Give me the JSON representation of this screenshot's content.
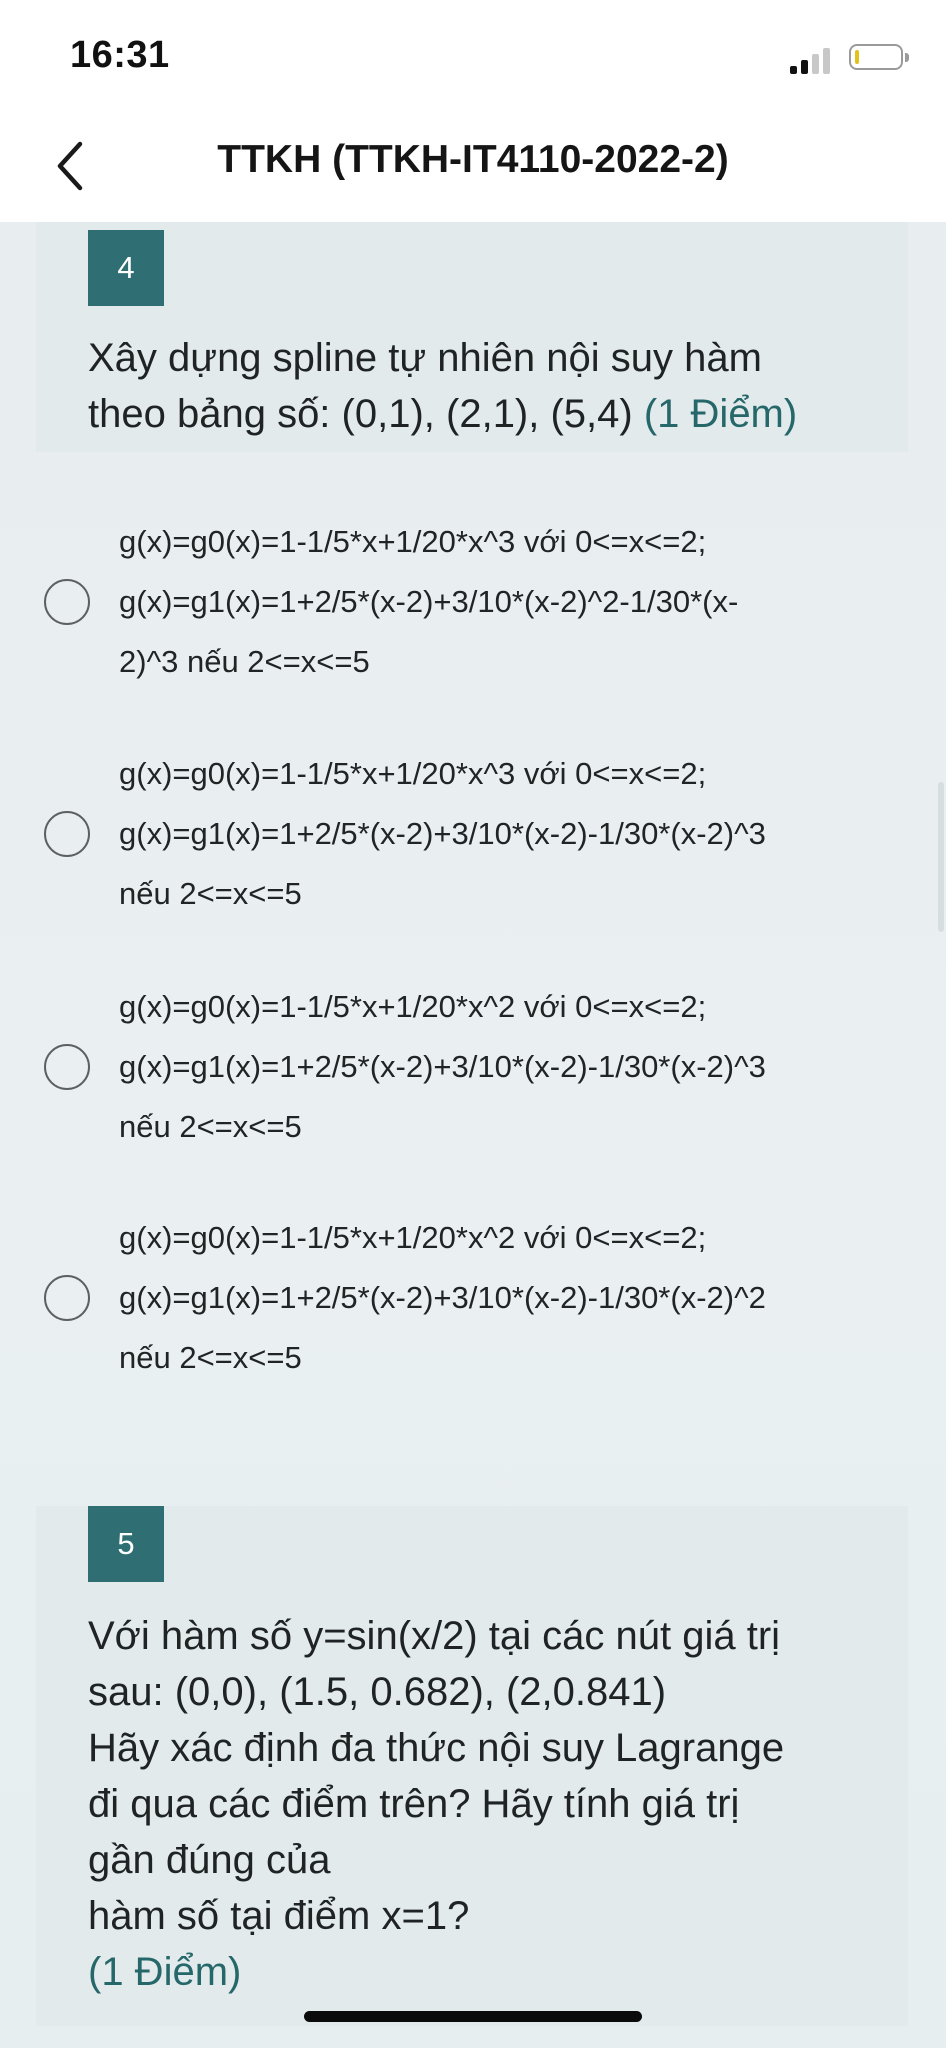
{
  "status_bar": {
    "time": "16:31",
    "battery_color": "#e2c21a"
  },
  "nav": {
    "back_icon": "chevron-left-icon",
    "title": "TTKH (TTKH-IT4110-2022-2)"
  },
  "question4": {
    "number": "4",
    "text": "Xây dựng spline tự nhiên nội suy hàm\ntheo bảng số: (0,1), (2,1), (5,4)",
    "points": "(1 Điểm)",
    "options": [
      {
        "lines": [
          "g(x)=g0(x)=1-1/5*x+1/20*x^3 với 0<=x<=2;",
          "g(x)=g1(x)=1+2/5*(x-2)+3/10*(x-2)^2-1/30*(x-",
          "2)^3 nếu 2<=x<=5"
        ]
      },
      {
        "lines": [
          "g(x)=g0(x)=1-1/5*x+1/20*x^3 với 0<=x<=2;",
          "g(x)=g1(x)=1+2/5*(x-2)+3/10*(x-2)-1/30*(x-2)^3",
          "nếu 2<=x<=5"
        ]
      },
      {
        "lines": [
          "g(x)=g0(x)=1-1/5*x+1/20*x^2 với 0<=x<=2;",
          "g(x)=g1(x)=1+2/5*(x-2)+3/10*(x-2)-1/30*(x-2)^3",
          "nếu 2<=x<=5"
        ]
      },
      {
        "lines": [
          "g(x)=g0(x)=1-1/5*x+1/20*x^2 với 0<=x<=2;",
          "g(x)=g1(x)=1+2/5*(x-2)+3/10*(x-2)-1/30*(x-2)^2",
          "nếu 2<=x<=5"
        ]
      }
    ]
  },
  "question5": {
    "number": "5",
    "text": "Với hàm số y=sin(x/2) tại các nút giá trị\nsau: (0,0), (1.5, 0.682), (2,0.841)\nHãy xác định đa thức nội suy Lagrange\nđi qua các điểm trên? Hãy tính giá trị\ngần đúng của\nhàm số tại điểm x=1?",
    "points": " (1 Điểm)"
  },
  "colors": {
    "accent": "#2f6e72",
    "points_text": "#26676a",
    "background": "#e9eff0"
  }
}
